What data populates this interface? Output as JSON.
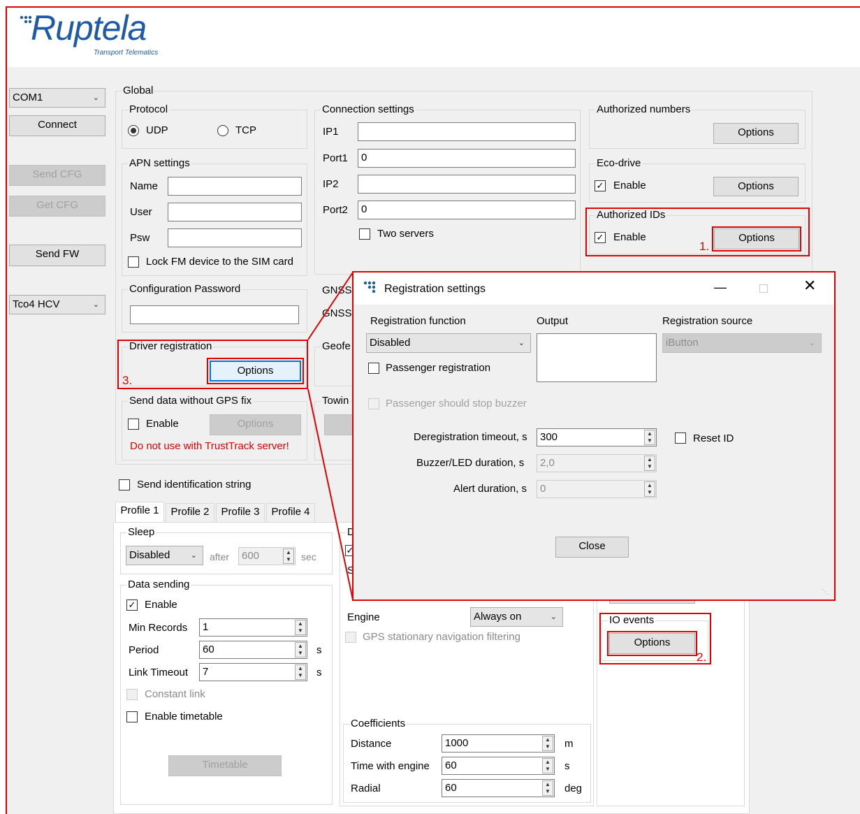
{
  "brand": {
    "name": "Ruptela",
    "tagline": "Transport Telematics",
    "color": "#1e5aa8"
  },
  "colors": {
    "accent_red": "#e00000"
  },
  "left": {
    "port": "COM1",
    "connect": "Connect",
    "send_cfg": "Send CFG",
    "get_cfg": "Get CFG",
    "send_fw": "Send FW",
    "device": "Tco4 HCV"
  },
  "global": {
    "title": "Global"
  },
  "protocol": {
    "title": "Protocol",
    "udp": "UDP",
    "tcp": "TCP"
  },
  "apn": {
    "title": "APN settings",
    "name": "Name",
    "user": "User",
    "psw": "Psw",
    "lock": "Lock FM device to the SIM card"
  },
  "connection": {
    "title": "Connection settings",
    "ip1": "IP1",
    "port1": "Port1",
    "port1_value": "0",
    "ip2": "IP2",
    "port2": "Port2",
    "port2_value": "0",
    "two_servers": "Two servers"
  },
  "authorized_numbers": {
    "title": "Authorized numbers",
    "options": "Options"
  },
  "eco": {
    "title": "Eco-drive",
    "enable": "Enable",
    "options": "Options"
  },
  "auth_ids": {
    "title": "Authorized IDs",
    "enable": "Enable",
    "options": "Options",
    "marker": "1."
  },
  "config_password": {
    "title": "Configuration Password"
  },
  "gnss": {
    "label1": "GNSS",
    "label2": "GNSS"
  },
  "driver_reg": {
    "title": "Driver registration",
    "options": "Options",
    "marker": "3."
  },
  "geofence": {
    "title": "Geofe"
  },
  "towing": {
    "title": "Towin"
  },
  "nogps": {
    "title": "Send data without GPS fix",
    "enable": "Enable",
    "options": "Options",
    "warning": "Do not use with TrustTrack server!"
  },
  "ident": {
    "label": "Send identification string"
  },
  "tabs": [
    "Profile 1",
    "Profile 2",
    "Profile 3",
    "Profile 4"
  ],
  "sleep": {
    "title": "Sleep",
    "mode": "Disabled",
    "after": "after",
    "value": "600",
    "unit": "sec"
  },
  "data_sending": {
    "title": "Data sending",
    "enable": "Enable",
    "min_records": "Min Records",
    "min_records_value": "1",
    "period": "Period",
    "period_value": "60",
    "period_unit": "s",
    "link_timeout": "Link Timeout",
    "link_timeout_value": "7",
    "link_unit": "s",
    "constant_link": "Constant link",
    "enable_timetable": "Enable timetable",
    "timetable": "Timetable"
  },
  "profile_mid": {
    "d": "D",
    "s": "S",
    "engine": "Engine",
    "engine_value": "Always on",
    "gps_filter": "GPS stationary navigation filtering"
  },
  "coefficients": {
    "title": "Coefficients",
    "distance": "Distance",
    "distance_value": "1000",
    "distance_unit": "m",
    "time_engine": "Time with engine",
    "time_engine_value": "60",
    "time_unit": "s",
    "radial": "Radial",
    "radial_value": "60",
    "radial_unit": "deg"
  },
  "io_events": {
    "title": "IO events",
    "options": "Options",
    "marker": "2."
  },
  "dialog": {
    "title": "Registration settings",
    "reg_function_label": "Registration function",
    "reg_function": "Disabled",
    "output_label": "Output",
    "reg_source_label": "Registration source",
    "reg_source": "iButton",
    "passenger_reg": "Passenger registration",
    "passenger_stop": "Passenger should stop buzzer",
    "dereg_label": "Deregistration timeout, s",
    "dereg_value": "300",
    "reset_id": "Reset ID",
    "buzzer_label": "Buzzer/LED duration, s",
    "buzzer_value": "2,0",
    "alert_label": "Alert duration, s",
    "alert_value": "0",
    "close": "Close"
  }
}
